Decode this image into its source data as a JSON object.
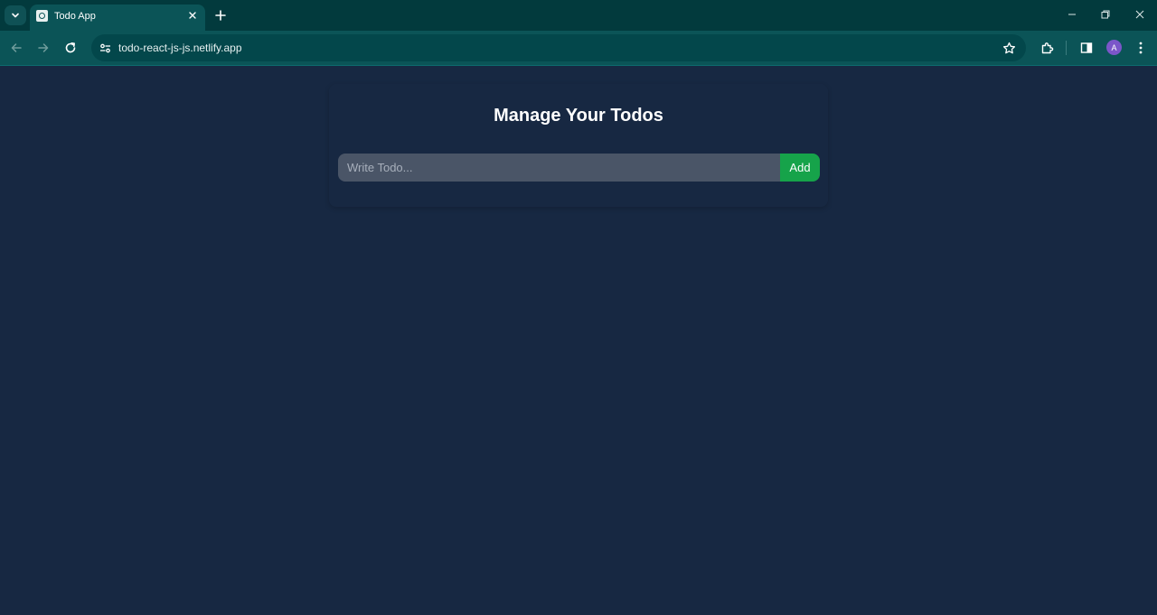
{
  "browser": {
    "tab": {
      "title": "Todo App"
    },
    "address_bar": {
      "url": "todo-react-js-js.netlify.app"
    },
    "profile": {
      "initial": "A"
    }
  },
  "app": {
    "title": "Manage Your Todos",
    "input": {
      "value": "",
      "placeholder": "Write Todo..."
    },
    "add_button_label": "Add",
    "todos": []
  },
  "colors": {
    "page_background": "#172842",
    "chrome_frame": "#023a3d",
    "chrome_toolbar": "#0b5457",
    "input_background": "#4a5567",
    "add_button": "#16a34a",
    "avatar": "#7b56c9"
  }
}
